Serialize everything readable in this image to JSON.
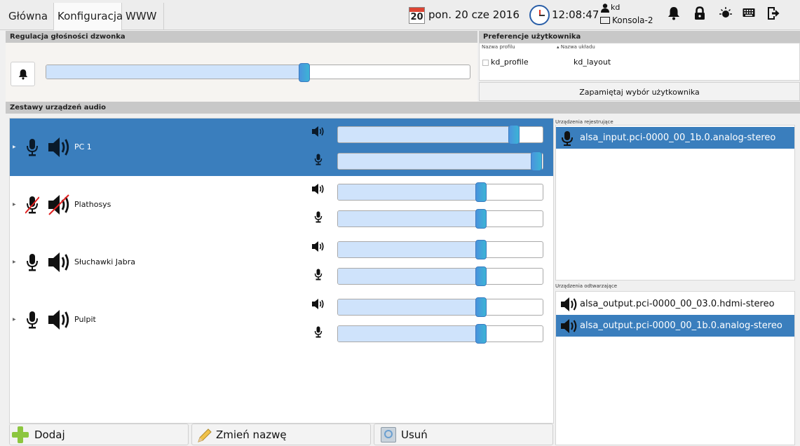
{
  "tabs": [
    {
      "label": "Główna",
      "active": false
    },
    {
      "label": "Konfiguracja",
      "active": true
    },
    {
      "label": "WWW",
      "active": false
    }
  ],
  "status": {
    "calendar_day": "20",
    "date": "pon. 20 cze 2016",
    "time": "12:08:47",
    "user": "kd",
    "console": "Konsola-2"
  },
  "toolbar_icons": [
    "bell-icon",
    "lock-icon",
    "brightness-icon",
    "keyboard-icon",
    "logout-icon"
  ],
  "ringer": {
    "title": "Regulacja głośności dzwonka",
    "volume": 0.61
  },
  "preferences": {
    "title": "Preferencje użytkownika",
    "col_profile": "Nazwa profilu",
    "col_layout": "▴ Nazwa układu",
    "profile_name": "kd_profile",
    "layout_name": "kd_layout",
    "save_button": "Zapamiętaj wybór użytkownika"
  },
  "audio_sets": {
    "title": "Zestawy urządzeń audio",
    "items": [
      {
        "name": "PC 1",
        "selected": true,
        "muted": false,
        "output_volume": 0.86,
        "input_volume": 0.97
      },
      {
        "name": "Plathosys",
        "selected": false,
        "muted": true,
        "output_volume": 0.7,
        "input_volume": 0.7
      },
      {
        "name": "Słuchawki Jabra",
        "selected": false,
        "muted": false,
        "output_volume": 0.7,
        "input_volume": 0.7
      },
      {
        "name": "Pulpit",
        "selected": false,
        "muted": false,
        "output_volume": 0.7,
        "input_volume": 0.7
      }
    ]
  },
  "recording_devices": {
    "label": "Urządzenia rejestrujące",
    "items": [
      {
        "name": "alsa_input.pci-0000_00_1b.0.analog-stereo",
        "selected": true
      }
    ]
  },
  "playback_devices": {
    "label": "Urządzenia odtwarzające",
    "items": [
      {
        "name": "alsa_output.pci-0000_00_03.0.hdmi-stereo",
        "selected": false
      },
      {
        "name": "alsa_output.pci-0000_00_1b.0.analog-stereo",
        "selected": true
      }
    ]
  },
  "buttons": {
    "add": "Dodaj",
    "rename": "Zmień nazwę",
    "remove": "Usuń"
  }
}
